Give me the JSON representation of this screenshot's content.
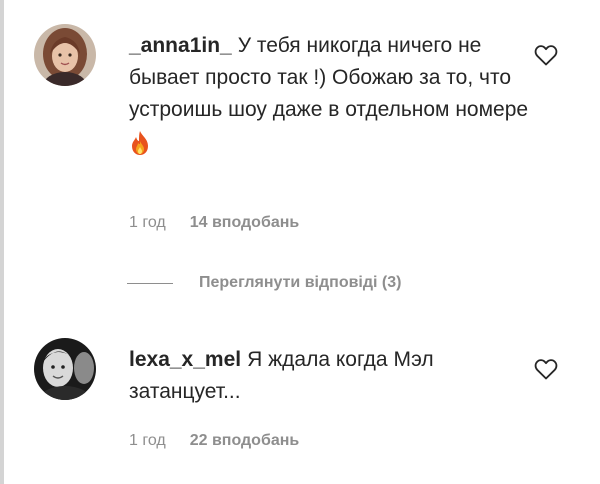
{
  "comments": [
    {
      "username": "_anna1in_",
      "text": "У тебя никогда ничего не бывает просто так !) Обожаю за то, что устроишь шоу даже в отдельном номере",
      "emoji": "fire-emoji",
      "time": "1 год",
      "likes": "14 вподобань",
      "avatar": "avatar-woman-photo",
      "like_icon": "heart-outline-icon"
    },
    {
      "username": "lexa_x_mel",
      "text": "Я ждала когда Мэл затанцует...",
      "time": "1 год",
      "likes": "22 вподобань",
      "avatar": "avatar-dark-photo",
      "like_icon": "heart-outline-icon"
    }
  ],
  "replies": {
    "label": "Переглянути відповіді (3)"
  },
  "colors": {
    "text": "#262626",
    "secondary": "#8e8e8e",
    "background": "#ffffff"
  }
}
